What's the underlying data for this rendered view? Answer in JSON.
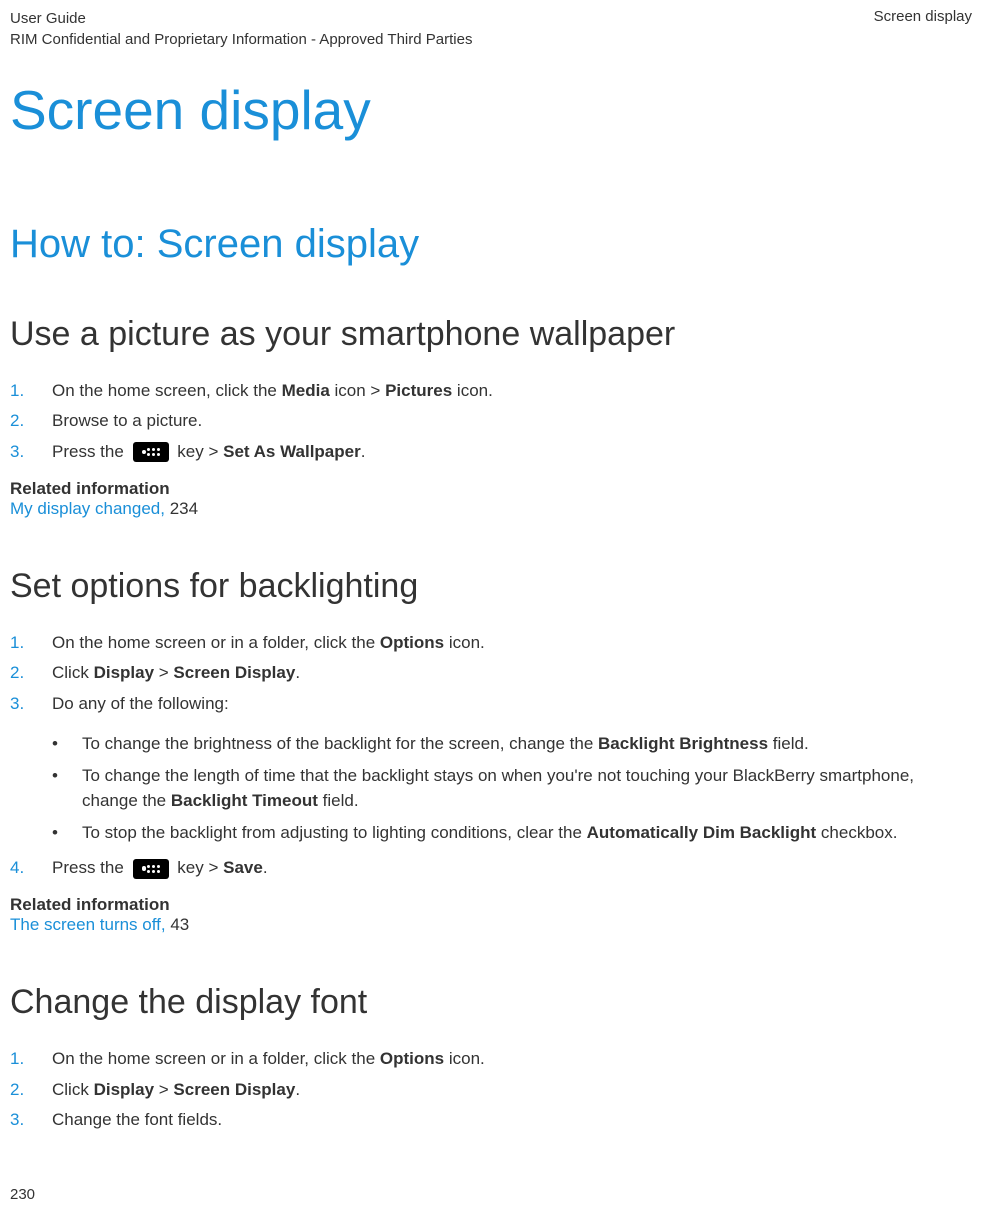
{
  "header": {
    "left1": "User Guide",
    "left2": "RIM Confidential and Proprietary Information - Approved Third Parties",
    "right": "Screen display"
  },
  "h1": "Screen display",
  "h2": "How to: Screen display",
  "sec1": {
    "title": "Use a picture as your smartphone wallpaper",
    "step1a": "On the home screen, click the ",
    "step1b": "Media",
    "step1c": " icon > ",
    "step1d": "Pictures",
    "step1e": " icon.",
    "step2": "Browse to a picture.",
    "step3a": " Press the ",
    "step3b": " key > ",
    "step3c": "Set As Wallpaper",
    "step3d": ".",
    "relLabel": "Related information",
    "relLink": "My display changed, ",
    "relPage": "234"
  },
  "sec2": {
    "title": "Set options for backlighting",
    "step1a": "On the home screen or in a folder, click the ",
    "step1b": "Options",
    "step1c": " icon.",
    "step2a": "Click ",
    "step2b": "Display",
    "step2c": " > ",
    "step2d": "Screen Display",
    "step2e": ".",
    "step3": "Do any of the following:",
    "b1a": "To change the brightness of the backlight for the screen, change the ",
    "b1b": "Backlight Brightness",
    "b1c": " field.",
    "b2a": "To change the length of time that the backlight stays on when you're not touching your BlackBerry smartphone, change the ",
    "b2b": "Backlight Timeout",
    "b2c": " field.",
    "b3a": "To stop the backlight from adjusting to lighting conditions, clear the ",
    "b3b": "Automatically Dim Backlight",
    "b3c": " checkbox.",
    "step4a": " Press the ",
    "step4b": " key > ",
    "step4c": "Save",
    "step4d": ".",
    "relLabel": "Related information",
    "relLink": "The screen turns off, ",
    "relPage": "43"
  },
  "sec3": {
    "title": "Change the display font",
    "step1a": "On the home screen or in a folder, click the ",
    "step1b": "Options",
    "step1c": " icon.",
    "step2a": "Click ",
    "step2b": "Display",
    "step2c": " > ",
    "step2d": "Screen Display",
    "step2e": ".",
    "step3": "Change the font fields."
  },
  "pageNumber": "230"
}
